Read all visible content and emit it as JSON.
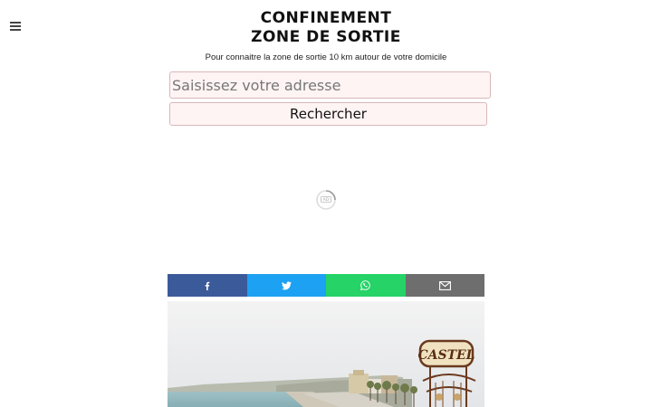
{
  "header": {
    "menu_icon": "hamburger-menu-icon",
    "title_line1": "CONFINEMENT",
    "title_line2": "ZONE DE SORTIE",
    "subtitle": "Pour connaitre la zone de sortie 10 km autour de votre domicile"
  },
  "search": {
    "placeholder": "Saisissez votre adresse",
    "value": "",
    "button_label": "Rechercher"
  },
  "ad": {
    "icon": "ad-loading-spinner-icon",
    "label": "AD"
  },
  "share": {
    "buttons": [
      {
        "network": "facebook",
        "icon": "facebook-icon",
        "color": "#3b5a9a"
      },
      {
        "network": "twitter",
        "icon": "twitter-icon",
        "color": "#1da1f2"
      },
      {
        "network": "whatsapp",
        "icon": "whatsapp-icon",
        "color": "#25d366"
      },
      {
        "network": "email",
        "icon": "envelope-icon",
        "color": "#6e6e6e"
      }
    ]
  },
  "photo": {
    "sign_text": "CASTEL"
  }
}
